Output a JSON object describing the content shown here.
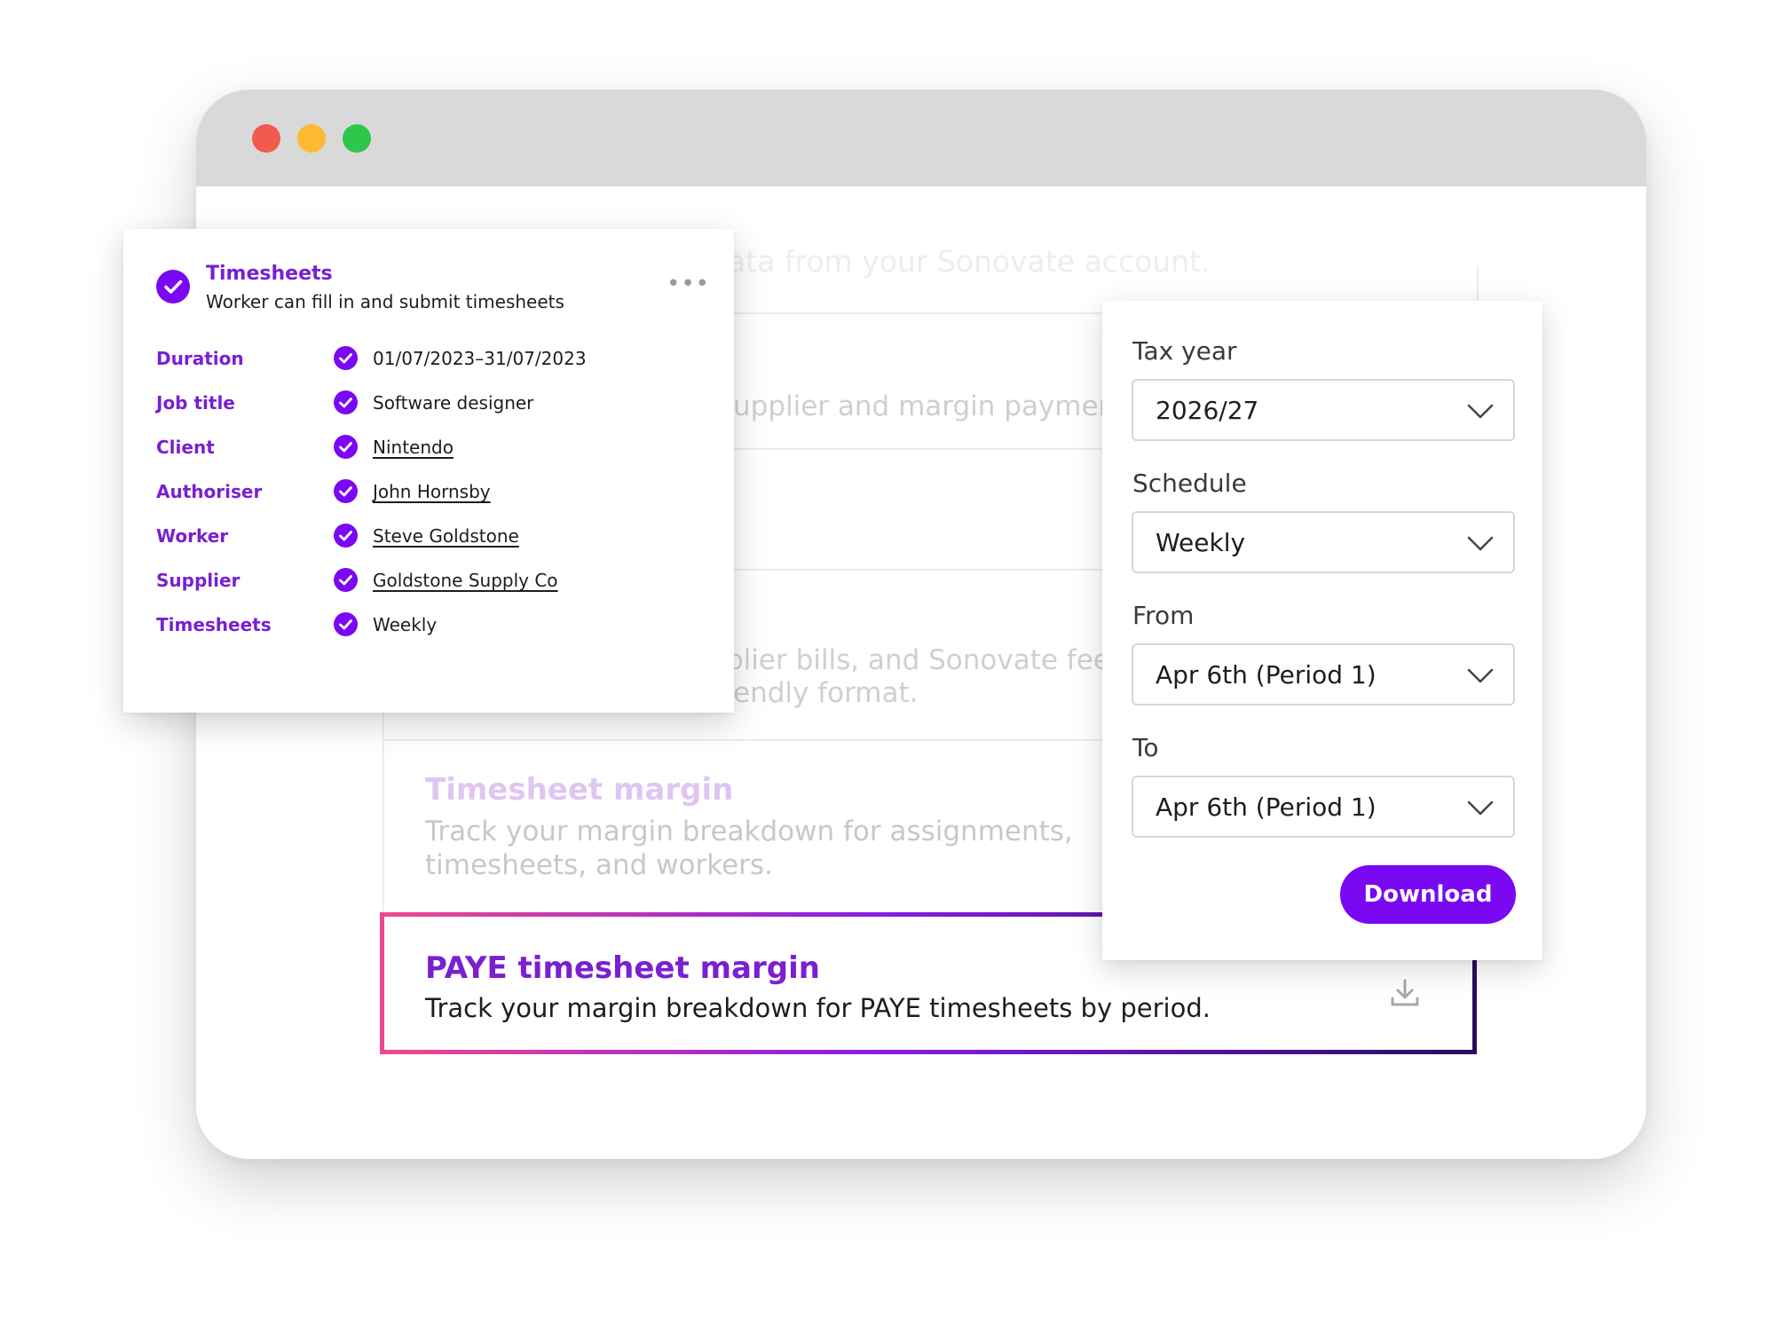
{
  "colors": {
    "accent": "#7a1fd1",
    "button": "#7a08f2",
    "check": "#7a08f2"
  },
  "background": {
    "faded_lines": [
      "ata from your Sonovate account.",
      "upplier and margin payment",
      "plier bills, and Sonovate fee b",
      "endly format."
    ],
    "timesheet_margin": {
      "title": "Timesheet margin",
      "description": "Track your margin breakdown for assignments, timesheets, and workers."
    }
  },
  "paye_card": {
    "title": "PAYE timesheet margin",
    "description": "Track your margin breakdown for PAYE timesheets by period.",
    "icon": "download-icon"
  },
  "timesheets_card": {
    "title": "Timesheets",
    "subtitle": "Worker can fill in and submit timesheets",
    "more_icon": "•••",
    "rows": [
      {
        "label": "Duration",
        "value": "01/07/2023–31/07/2023"
      },
      {
        "label": "Job title",
        "value": "Software designer"
      },
      {
        "label": "Client",
        "value": "Nintendo"
      },
      {
        "label": "Authoriser",
        "value": "John Hornsby"
      },
      {
        "label": "Worker",
        "value": "Steve Goldstone"
      },
      {
        "label": "Supplier",
        "value": "Goldstone Supply Co"
      },
      {
        "label": "Timesheets",
        "value": "Weekly"
      }
    ]
  },
  "download_form": {
    "tax_year": {
      "label": "Tax year",
      "value": "2026/27"
    },
    "schedule": {
      "label": "Schedule",
      "value": "Weekly"
    },
    "from": {
      "label": "From",
      "value": "Apr 6th (Period 1)"
    },
    "to": {
      "label": "To",
      "value": "Apr 6th (Period 1)"
    },
    "download_label": "Download"
  }
}
